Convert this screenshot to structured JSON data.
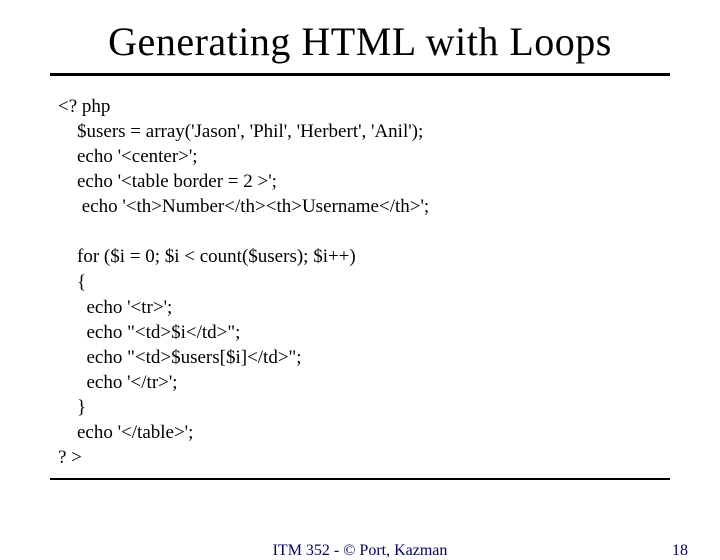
{
  "title": "Generating HTML with Loops",
  "code": {
    "l1": "<? php",
    "l2": "    $users = array('Jason', 'Phil', 'Herbert', 'Anil');",
    "l3": "    echo '<center>';",
    "l4": "    echo '<table border = 2 >';",
    "l5": "     echo '<th>Number</th><th>Username</th>';",
    "l6": "",
    "l7": "    for ($i = 0; $i < count($users); $i++)",
    "l8": "    {",
    "l9": "      echo '<tr>';",
    "l10": "      echo \"<td>$i</td>\";",
    "l11": "      echo \"<td>$users[$i]</td>\";",
    "l12": "      echo '</tr>';",
    "l13": "    }",
    "l14": "    echo '</table>';",
    "l15": "? >"
  },
  "footer": {
    "center": "ITM 352 - © Port, Kazman",
    "page": "18"
  }
}
